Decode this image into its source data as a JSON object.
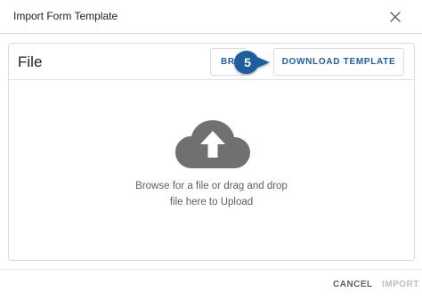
{
  "dialog": {
    "title": "Import Form Template",
    "close_icon": "close-icon"
  },
  "card": {
    "title": "File",
    "browse_label": "BRO",
    "download_label": "DOWNLOAD TEMPLATE",
    "step_badge": "5",
    "step_badge_color": "#1d5fa0"
  },
  "drop_zone": {
    "icon": "cloud-upload-icon",
    "line1": "Browse for a file or drag and drop",
    "line2": "file here to Upload"
  },
  "footer": {
    "cancel_label": "CANCEL",
    "import_label": "IMPORT"
  },
  "colors": {
    "accent": "#1d5fa0",
    "icon_gray": "#707070",
    "disabled": "#bdbdbd"
  }
}
